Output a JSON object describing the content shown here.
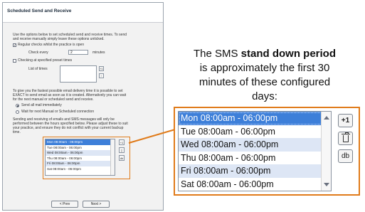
{
  "dialog": {
    "title": "Scheduled Send and Receive",
    "intro": [
      "Use the options below to set scheduled send and receive times. To send",
      "and receive manually simply leave these options unticked."
    ],
    "regular_checks_label": "Regular checks whilst the practice is open",
    "regular_checks_checked": true,
    "check_every_label": "Check every",
    "check_every_value": "2",
    "check_every_unit": "minutes",
    "preset_times_label": "Checking at specified preset times",
    "preset_times_checked": false,
    "list_of_times_label": "List of times",
    "fastest_text": [
      "To give you the fastest possible email delivery time it is possible to set",
      "EXACT to send email as soon as it is created. Alternatively you can wait",
      "for the next manual or scheduled send and receive."
    ],
    "send_immediately_label": "Send all mail immediately",
    "wait_label": "Wait for next Manual or Scheduled connection",
    "sms_text": [
      "Sending and receiving of emails and SMS messages will only be",
      "performed between the hours specified below. Please adjust these to suit",
      "your practice, and ensure they do not conflict with your current backup",
      "time."
    ],
    "prev_label": "< Prev",
    "next_label": "Next >"
  },
  "annotation": {
    "line1_prefix": "The SMS ",
    "line1_bold": "stand down period",
    "line2": "is approximately the first 30",
    "line3": "minutes of these configured",
    "line4": "days:"
  },
  "times": [
    "Mon 08:00am - 06:00pm",
    "Tue 08:00am - 06:00pm",
    "Wed 08:00am - 06:00pm",
    "Thu 08:00am - 06:00pm",
    "Fri 08:00am - 06:00pm",
    "Sat 08:00am - 06:00pm"
  ],
  "list_buttons": {
    "add_label": "+1",
    "delete_icon": "trash-icon",
    "edit_label": "db"
  },
  "colors": {
    "highlight": "#e07b1a",
    "selection": "#3d7fd9"
  }
}
